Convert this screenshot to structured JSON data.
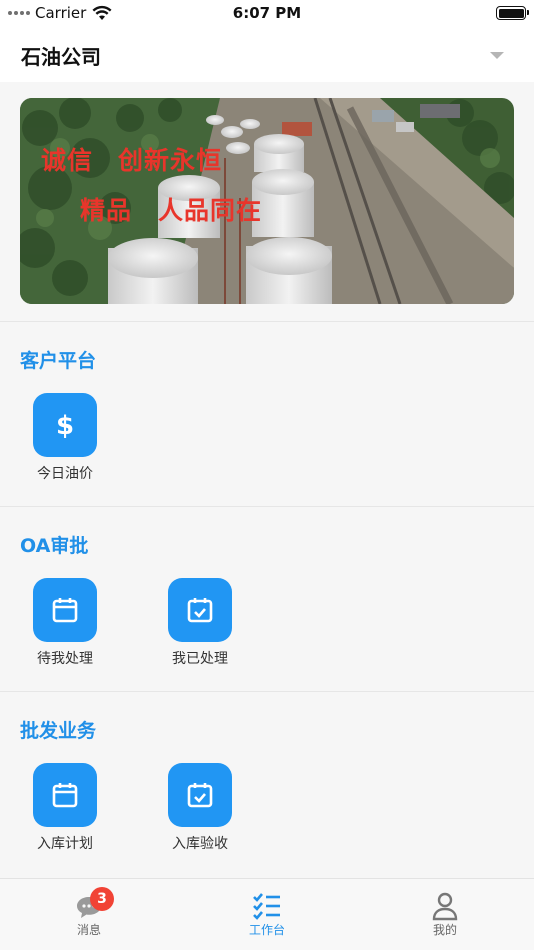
{
  "status_bar": {
    "carrier": "Carrier",
    "time": "6:07 PM"
  },
  "header": {
    "title": "石油公司"
  },
  "banner": {
    "slogan_line1_a": "诚信",
    "slogan_line1_b": "创新永恒",
    "slogan_line2_a": "精品",
    "slogan_line2_b": "人品同在",
    "slogan_color": "#e8352b"
  },
  "sections": [
    {
      "title": "客户平台",
      "items": [
        {
          "label": "今日油价",
          "icon": "dollar-icon"
        }
      ]
    },
    {
      "title": "OA审批",
      "items": [
        {
          "label": "待我处理",
          "icon": "calendar-icon"
        },
        {
          "label": "我已处理",
          "icon": "calendar-check-icon"
        }
      ]
    },
    {
      "title": "批发业务",
      "items": [
        {
          "label": "入库计划",
          "icon": "calendar-icon"
        },
        {
          "label": "入库验收",
          "icon": "calendar-check-icon"
        }
      ]
    }
  ],
  "tab_bar": {
    "tabs": [
      {
        "label": "消息",
        "icon": "chat-bubble-icon",
        "badge": "3"
      },
      {
        "label": "工作台",
        "icon": "task-list-icon",
        "active": true
      },
      {
        "label": "我的",
        "icon": "person-icon"
      }
    ]
  },
  "colors": {
    "accent": "#2196f3",
    "section_title": "#2190e8",
    "badge": "#f14335"
  }
}
